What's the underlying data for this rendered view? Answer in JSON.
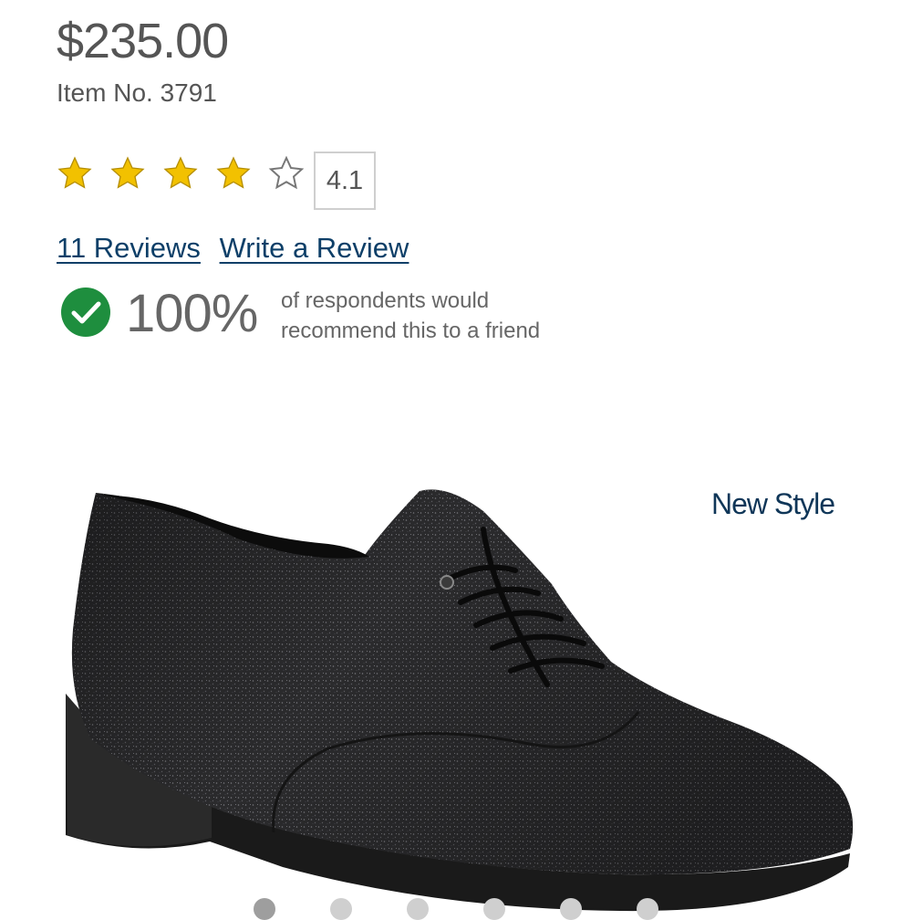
{
  "product": {
    "price": "$235.00",
    "item_number": "Item No. 3791"
  },
  "rating": {
    "value": "4.1",
    "stars_filled": 4,
    "stars_total": 5,
    "star_color": "#f2c100"
  },
  "reviews": {
    "count_link": "11 Reviews",
    "write_link": "Write a Review",
    "link_color": "#0d3f68"
  },
  "recommend": {
    "percent": "100%",
    "line1": "of respondents would",
    "line2": "recommend this to a friend",
    "check_color": "#1e8e3e"
  },
  "image": {
    "badge": "New Style",
    "carousel_dots": 6,
    "active_dot": 0
  }
}
